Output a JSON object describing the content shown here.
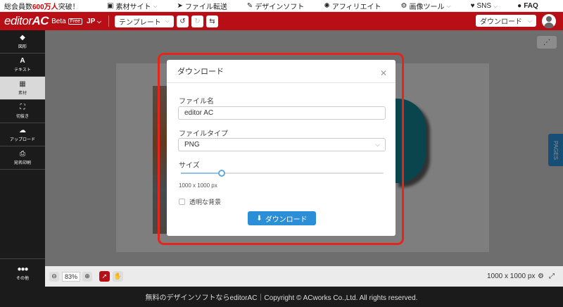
{
  "topbar": {
    "promo_prefix": "総会員数",
    "promo_highlight": "600万人",
    "promo_suffix": "突破！",
    "links": [
      {
        "label": "素材サイト",
        "icon": "image-icon",
        "has_menu": true
      },
      {
        "label": "ファイル転送",
        "icon": "paper-plane-icon",
        "has_menu": false
      },
      {
        "label": "デザインソフト",
        "icon": "paint-icon",
        "has_menu": false
      },
      {
        "label": "アフィリエイト",
        "icon": "sun-icon",
        "has_menu": false
      },
      {
        "label": "画像ツール",
        "icon": "gears-icon",
        "has_menu": true
      },
      {
        "label": "SNS",
        "icon": "heart-icon",
        "has_menu": true
      },
      {
        "label": "FAQ",
        "icon": "user-icon",
        "has_menu": false
      }
    ]
  },
  "appbar": {
    "logo_main": "editor",
    "logo_ac": "AC",
    "beta": "Beta",
    "free_badge": "Free",
    "lang": "JP",
    "template_label": "テンプレート",
    "download_label": "ダウンロード",
    "colors": {
      "brand": "#b80f17"
    }
  },
  "sidebar": {
    "items": [
      {
        "label": "図形",
        "icon": "shapes-icon"
      },
      {
        "label": "テキスト",
        "icon": "text-icon"
      },
      {
        "label": "素材",
        "icon": "grid-icon",
        "active": true
      },
      {
        "label": "切抜き",
        "icon": "crop-icon"
      },
      {
        "label": "アップロード",
        "icon": "cloud-upload-icon"
      },
      {
        "label": "宛名印刷",
        "icon": "printer-icon"
      }
    ],
    "other_label": "その他"
  },
  "workspace": {
    "pages_tab": "PAGES"
  },
  "bottombar": {
    "zoom": "83%",
    "canvas_size": "1000 x 1000 px"
  },
  "footer": {
    "text": "無料のデザインソフトならeditorAC｜Copyright © ACworks Co.,Ltd. All rights reserved."
  },
  "modal": {
    "title": "ダウンロード",
    "filename_label": "ファイル名",
    "filename_value": "editor AC",
    "filetype_label": "ファイルタイプ",
    "filetype_value": "PNG",
    "size_label": "サイズ",
    "size_slider_fraction": 0.2,
    "size_text": "1000 x 1000 px",
    "transparent_label": "透明な背景",
    "transparent_checked": false,
    "download_button": "ダウンロード",
    "colors": {
      "primary": "#2a8fd6",
      "highlight_border": "#e3251b"
    }
  }
}
